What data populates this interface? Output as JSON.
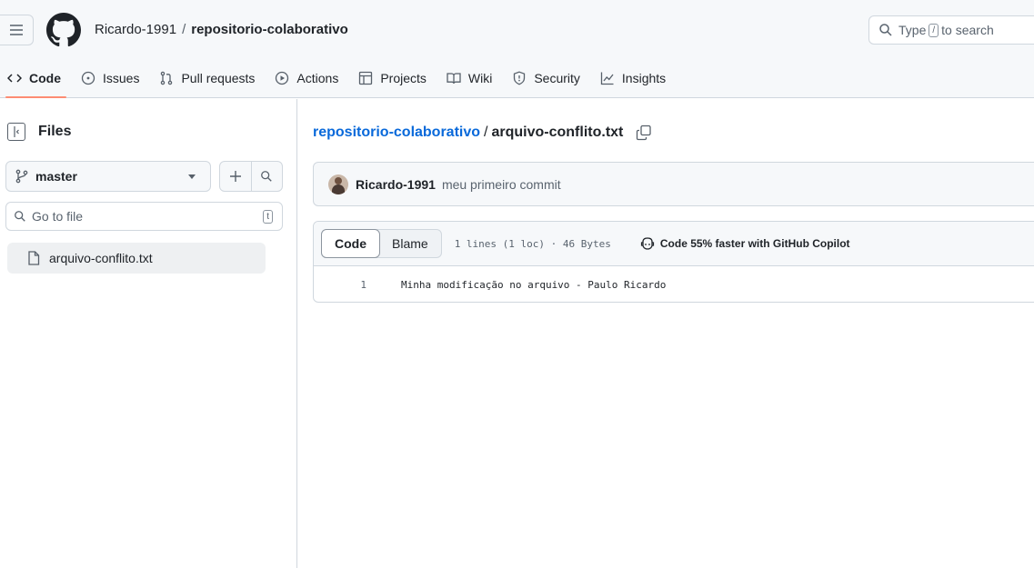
{
  "header": {
    "owner": "Ricardo-1991",
    "separator": "/",
    "repo": "repositorio-colaborativo",
    "search_prefix": "Type",
    "search_key": "/",
    "search_suffix": "to search"
  },
  "nav": {
    "tabs": [
      {
        "label": "Code",
        "icon": "code-icon",
        "active": true
      },
      {
        "label": "Issues",
        "icon": "issue-icon"
      },
      {
        "label": "Pull requests",
        "icon": "pull-request-icon"
      },
      {
        "label": "Actions",
        "icon": "play-icon"
      },
      {
        "label": "Projects",
        "icon": "table-icon"
      },
      {
        "label": "Wiki",
        "icon": "book-icon"
      },
      {
        "label": "Security",
        "icon": "shield-icon"
      },
      {
        "label": "Insights",
        "icon": "graph-icon"
      }
    ]
  },
  "sidebar": {
    "title": "Files",
    "branch": "master",
    "goto_placeholder": "Go to file",
    "goto_key": "t",
    "files": [
      {
        "name": "arquivo-conflito.txt"
      }
    ]
  },
  "main": {
    "breadcrumb_repo": "repositorio-colaborativo",
    "breadcrumb_sep": "/",
    "breadcrumb_file": "arquivo-conflito.txt",
    "commit": {
      "author": "Ricardo-1991",
      "message": "meu primeiro commit"
    },
    "file": {
      "tab_code": "Code",
      "tab_blame": "Blame",
      "info": "1 lines (1 loc) · 46 Bytes",
      "copilot": "Code 55% faster with GitHub Copilot",
      "lines": [
        {
          "num": "1",
          "text": "Minha modificação no arquivo - Paulo Ricardo"
        }
      ]
    }
  },
  "colors": {
    "accent_link": "#0969da",
    "active_tab_underline": "#fd8c73"
  }
}
